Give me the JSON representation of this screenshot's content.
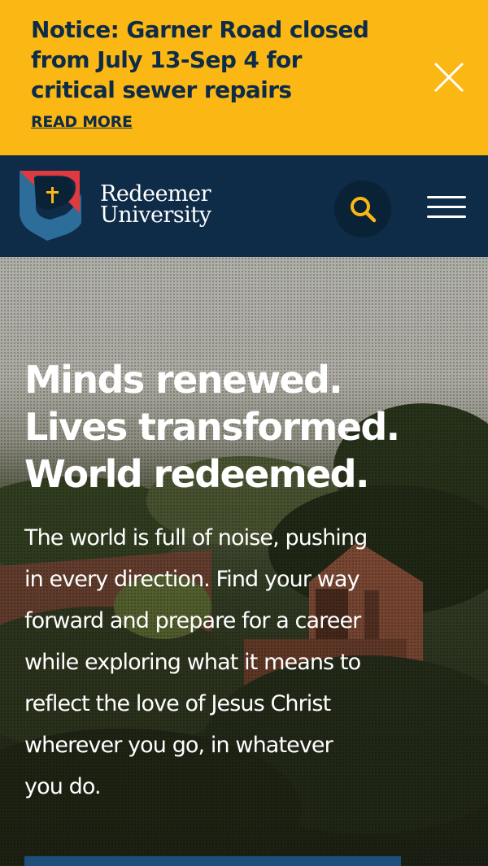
{
  "notice": {
    "title_lines": [
      "Notice: Garner Road closed",
      "from July 13-Sep 4 for",
      "critical sewer repairs"
    ],
    "link_label": "READ MORE",
    "close_icon": "close-icon",
    "background_color": "#fbb814"
  },
  "header": {
    "logo": {
      "line1": "Redeemer",
      "line2": "University"
    },
    "search_icon": "search-icon",
    "menu_icon": "hamburger-menu-icon",
    "background_color": "#0e2b47",
    "accent_color": "#fbb814"
  },
  "hero": {
    "heading_lines": [
      "Minds renewed.",
      "Lives transformed.",
      "World redeemed."
    ],
    "body_lines": [
      "The world is full of noise, pushing",
      "in every direction. Find your way",
      "forward and prepare for a career",
      "while exploring what it means to",
      "reflect the love of Jesus Christ",
      "wherever you go, in whatever",
      "you do."
    ],
    "cta_color": "#1e4f7a"
  }
}
